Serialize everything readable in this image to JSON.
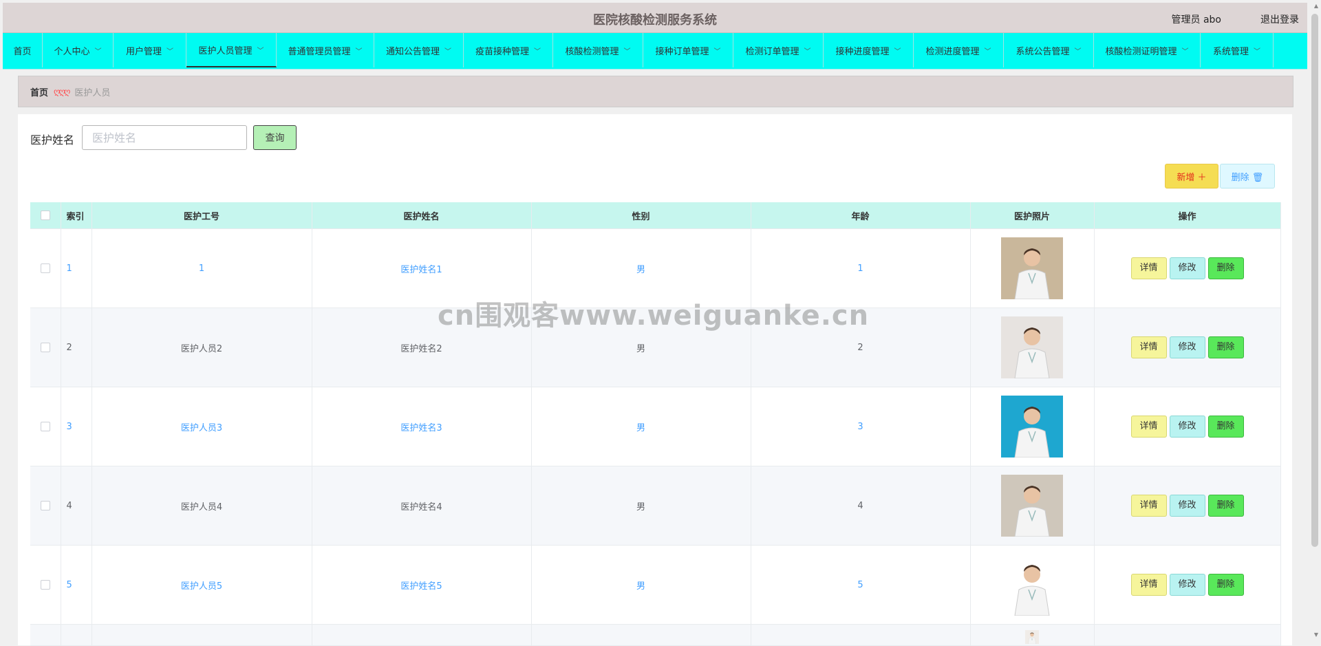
{
  "header": {
    "title": "医院核酸检测服务系统",
    "user_label": "管理员 abo",
    "logout_label": "退出登录"
  },
  "nav": [
    {
      "label": "首页",
      "dropdown": false,
      "active": false
    },
    {
      "label": "个人中心",
      "dropdown": true,
      "active": false
    },
    {
      "label": "用户管理",
      "dropdown": true,
      "active": false
    },
    {
      "label": "医护人员管理",
      "dropdown": true,
      "active": true
    },
    {
      "label": "普通管理员管理",
      "dropdown": true,
      "active": false
    },
    {
      "label": "通知公告管理",
      "dropdown": true,
      "active": false
    },
    {
      "label": "疫苗接种管理",
      "dropdown": true,
      "active": false
    },
    {
      "label": "核酸检测管理",
      "dropdown": true,
      "active": false
    },
    {
      "label": "接种订单管理",
      "dropdown": true,
      "active": false
    },
    {
      "label": "检测订单管理",
      "dropdown": true,
      "active": false
    },
    {
      "label": "接种进度管理",
      "dropdown": true,
      "active": false
    },
    {
      "label": "检测进度管理",
      "dropdown": true,
      "active": false
    },
    {
      "label": "系统公告管理",
      "dropdown": true,
      "active": false
    },
    {
      "label": "核酸检测证明管理",
      "dropdown": true,
      "active": false
    },
    {
      "label": "系统管理",
      "dropdown": true,
      "active": false
    }
  ],
  "breadcrumb": {
    "home": "首页",
    "separator": "ღღღ",
    "current": "医护人员"
  },
  "search": {
    "label": "医护姓名",
    "placeholder": "医护姓名",
    "value": "",
    "button_label": "查询"
  },
  "actions": {
    "add_label": "新增 ＋",
    "delete_label": "删除 🗑"
  },
  "table": {
    "headers": [
      "索引",
      "医护工号",
      "医护姓名",
      "性别",
      "年龄",
      "医护照片",
      "操作"
    ],
    "rows": [
      {
        "index": "1",
        "staff_id": "1",
        "name": "医护姓名1",
        "gender": "男",
        "age": "1"
      },
      {
        "index": "2",
        "staff_id": "医护人员2",
        "name": "医护姓名2",
        "gender": "男",
        "age": "2"
      },
      {
        "index": "3",
        "staff_id": "医护人员3",
        "name": "医护姓名3",
        "gender": "男",
        "age": "3"
      },
      {
        "index": "4",
        "staff_id": "医护人员4",
        "name": "医护姓名4",
        "gender": "男",
        "age": "4"
      },
      {
        "index": "5",
        "staff_id": "医护人员5",
        "name": "医护姓名5",
        "gender": "男",
        "age": "5"
      }
    ],
    "op_labels": {
      "detail": "详情",
      "edit": "修改",
      "delete": "删除"
    }
  },
  "watermark": "cn围观客www.weiguanke.cn",
  "colors": {
    "header_bg": "#ddd5d5",
    "nav_bg": "#00fbf2",
    "table_header_bg": "#c6f6ee",
    "link": "#409eff",
    "add_button": "#f5dd53",
    "search_button": "#b5f0b6"
  }
}
